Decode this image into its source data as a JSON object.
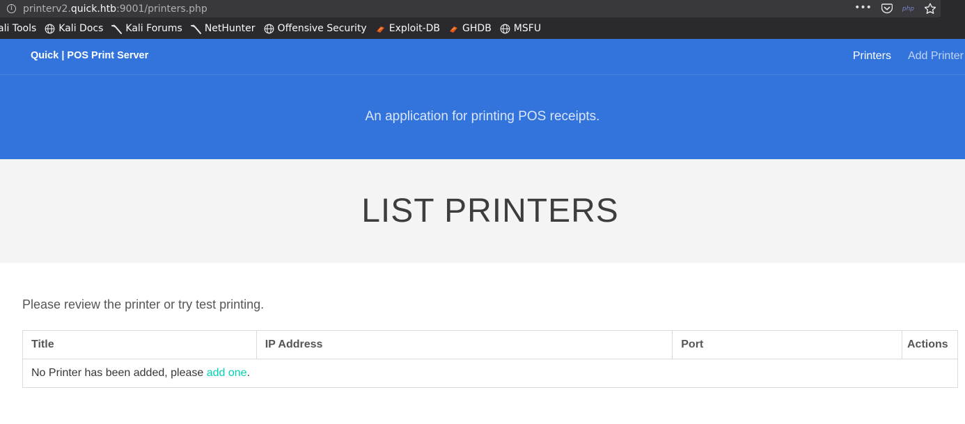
{
  "browser": {
    "url_prefix": "printerv2.",
    "url_host": "quick.htb",
    "url_suffix": ":9001/printers.php",
    "url_badge": "php",
    "bookmarks": [
      {
        "label": "ali Tools",
        "icon": "kali-icon"
      },
      {
        "label": "Kali Docs",
        "icon": "globe-icon"
      },
      {
        "label": "Kali Forums",
        "icon": "kali-dragon-icon"
      },
      {
        "label": "NetHunter",
        "icon": "kali-dragon-icon"
      },
      {
        "label": "Offensive Security",
        "icon": "globe-icon"
      },
      {
        "label": "Exploit-DB",
        "icon": "exploitdb-icon"
      },
      {
        "label": "GHDB",
        "icon": "exploitdb-icon"
      },
      {
        "label": "MSFU",
        "icon": "globe-icon"
      }
    ]
  },
  "navbar": {
    "brand": "Quick | POS Print Server",
    "links": [
      {
        "label": "Printers",
        "active": true
      },
      {
        "label": "Add Printer",
        "active": false
      }
    ]
  },
  "hero": {
    "subtitle": "An application for printing POS receipts."
  },
  "section": {
    "title": "LIST PRINTERS",
    "intro": "Please review the printer or try test printing."
  },
  "table": {
    "headers": [
      "Title",
      "IP Address",
      "Port",
      "Actions"
    ],
    "empty_text_before": "No Printer has been added, please ",
    "empty_link": "add one",
    "empty_text_after": "."
  },
  "colors": {
    "primary": "#3273dc",
    "link": "#00d1b2",
    "band": "#f4f4f4"
  }
}
